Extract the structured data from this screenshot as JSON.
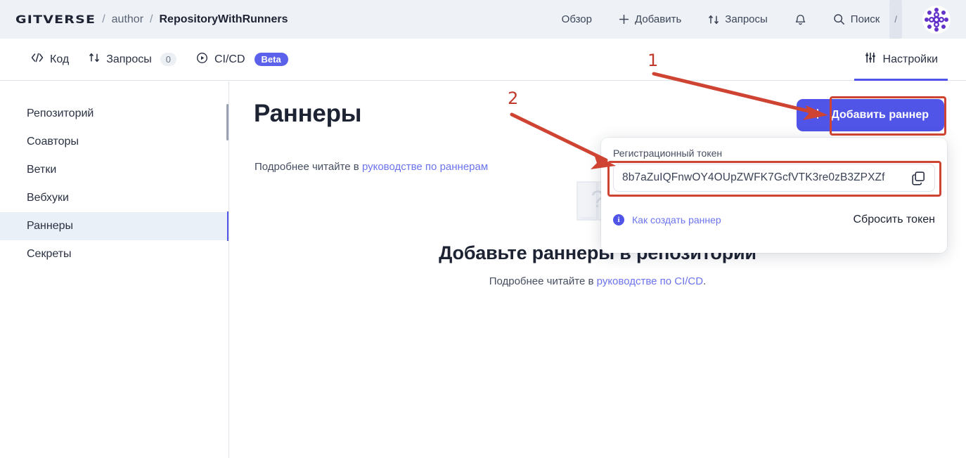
{
  "header": {
    "logo": "GITVERSE",
    "separator": "/",
    "owner": "author",
    "repo": "RepositoryWithRunners",
    "nav": [
      {
        "label": "Обзор",
        "icon": "none"
      },
      {
        "label": "Добавить",
        "icon": "plus-icon"
      },
      {
        "label": "Запросы",
        "icon": "pull-request-icon"
      },
      {
        "label": "",
        "icon": "bell-icon"
      },
      {
        "label": "Поиск",
        "icon": "search-icon",
        "shortcut": "/"
      }
    ],
    "avatar_alt": "user-avatar"
  },
  "tabs": {
    "items": [
      {
        "label": "Код",
        "icon": "code-icon",
        "count": null,
        "badge": null,
        "active": false
      },
      {
        "label": "Запросы",
        "icon": "pull-request-icon",
        "count": "0",
        "badge": null,
        "active": false
      },
      {
        "label": "CI/CD",
        "icon": "play-circle-icon",
        "count": null,
        "badge": "Beta",
        "active": false
      }
    ],
    "settings": {
      "label": "Настройки",
      "icon": "sliders-icon",
      "active": true
    }
  },
  "sidebar": {
    "items": [
      {
        "label": "Репозиторий",
        "active": false
      },
      {
        "label": "Соавторы",
        "active": false
      },
      {
        "label": "Ветки",
        "active": false
      },
      {
        "label": "Вебхуки",
        "active": false
      },
      {
        "label": "Раннеры",
        "active": true
      },
      {
        "label": "Секреты",
        "active": false
      }
    ]
  },
  "main": {
    "title": "Раннеры",
    "subtitle_prefix": "Подробнее читайте в ",
    "subtitle_link": "руководстве по раннерам",
    "add_button": "Добавить раннер",
    "add_button_icon": "plus-icon",
    "empty": {
      "illustration": "document-question-icon",
      "title": "Добавьте раннеры в репозиторий",
      "sub_prefix": "Подробнее читайте в ",
      "sub_link": "руководстве по CI/CD",
      "sub_suffix": "."
    }
  },
  "popup": {
    "label": "Регистрационный токен",
    "token": "8b7aZuIQFnwOY4OUpZWFK7GcfVTK3re0zB3ZPXZf",
    "copy_icon": "copy-icon",
    "info_icon": "info-icon",
    "info_char": "i",
    "how_link": "Как создать раннер",
    "reset_link": "Сбросить токен"
  },
  "annotations": {
    "items": [
      {
        "number": "1",
        "target": "add-runner-button"
      },
      {
        "number": "2",
        "target": "registration-token-field"
      }
    ],
    "color": "#cf4332"
  },
  "colors": {
    "accent": "#5055e8",
    "header_bg": "#eef1f5",
    "text": "#1d2333",
    "link": "#6b74ee",
    "annotation": "#cf4332"
  }
}
